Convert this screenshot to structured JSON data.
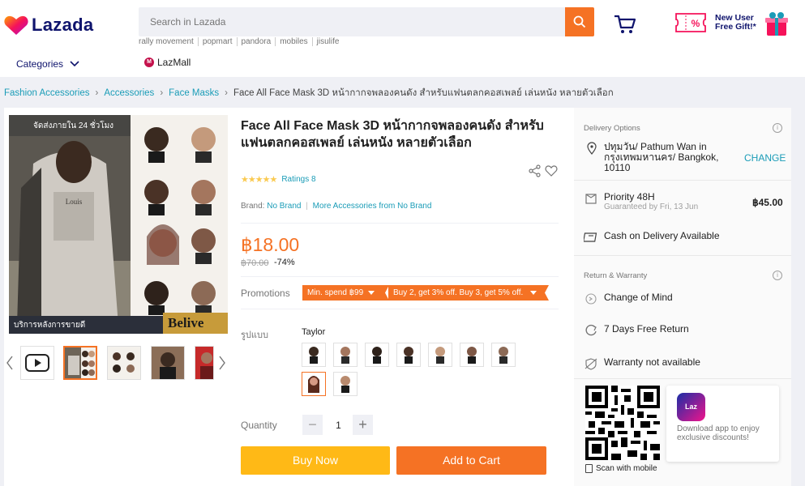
{
  "header": {
    "logo_text": "Lazada",
    "search_placeholder": "Search in Lazada",
    "hot_searches": [
      "rally movement",
      "popmart",
      "pandora",
      "mobiles",
      "jisulife"
    ],
    "promo_line1": "New User",
    "promo_line2": "Free Gift!*",
    "promo_badge": "%",
    "categories_label": "Categories",
    "lazmall_label": "LazMall"
  },
  "breadcrumb": {
    "items": [
      "Fashion Accessories",
      "Accessories",
      "Face Masks"
    ],
    "current": "Face All Face Mask 3D หน้ากากจพลองคนดัง สำหรับแฟนตลกคอสเพลย์ เล่นหนัง หลายตัวเลือก"
  },
  "gallery": {
    "banner_top": "จัดส่งภายใน 24 ชั่วโมง",
    "banner_bottom": "บริการหลังการขายดี",
    "banner_brand": "Belive"
  },
  "product": {
    "title": "Face All Face Mask 3D หน้ากากจพลองคนดัง สำหรับแฟนตลกคอสเพลย์ เล่นหนัง หลายตัวเลือก",
    "stars": "★★★★★",
    "ratings": "Ratings 8",
    "brand_label": "Brand:",
    "brand": "No Brand",
    "more_from": "More Accessories from No Brand",
    "price": "฿18.00",
    "old_price": "฿70.00",
    "discount": "-74%",
    "promotions_label": "Promotions",
    "promo_tag1": "Min. spend ฿99",
    "promo_tag2": "Buy 2, get 3% off. Buy 3, get 5% off.",
    "variant_label": "รูปแบบ",
    "variant_selected": "Taylor",
    "quantity_label": "Quantity",
    "quantity": "1",
    "minus": "−",
    "plus": "+",
    "buy_now": "Buy Now",
    "add_to_cart": "Add to Cart"
  },
  "side": {
    "delivery_header": "Delivery Options",
    "address_line1": "ปทุมวัน/ Pathum Wan in",
    "address_line2": "กรุงเทพมหานคร/ Bangkok,",
    "address_line3": "10110",
    "change": "CHANGE",
    "priority": "Priority 48H",
    "guaranteed": "Guaranteed by Fri, 13 Jun",
    "fee": "฿45.00",
    "cod": "Cash on Delivery Available",
    "return_header": "Return & Warranty",
    "change_of_mind": "Change of Mind",
    "free_return": "7 Days Free Return",
    "warranty": "Warranty not available",
    "scan": "Scan with mobile",
    "app_icon": "Laz",
    "app_text": "Download app to enjoy exclusive discounts!",
    "info_glyph": "i"
  },
  "colors": {
    "accent": "#f57224",
    "buy": "#ffb916",
    "link": "#1a9cb7",
    "brand_navy": "#0f146d"
  }
}
